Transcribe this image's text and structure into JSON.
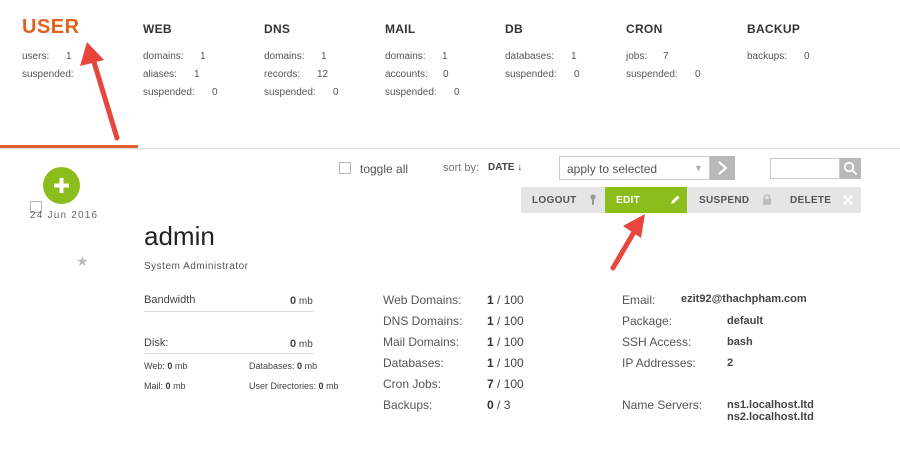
{
  "stats": {
    "user": {
      "title": "USER",
      "rows": [
        {
          "label": "users:",
          "value": "1"
        },
        {
          "label": "suspended:",
          "value": ""
        }
      ]
    },
    "web": {
      "title": "WEB",
      "rows": [
        {
          "label": "domains:",
          "value": "1"
        },
        {
          "label": "aliases:",
          "value": "1"
        },
        {
          "label": "suspended:",
          "value": "0"
        }
      ]
    },
    "dns": {
      "title": "DNS",
      "rows": [
        {
          "label": "domains:",
          "value": "1"
        },
        {
          "label": "records:",
          "value": "12"
        },
        {
          "label": "suspended:",
          "value": "0"
        }
      ]
    },
    "mail": {
      "title": "MAIL",
      "rows": [
        {
          "label": "domains:",
          "value": "1"
        },
        {
          "label": "accounts:",
          "value": "0"
        },
        {
          "label": "suspended:",
          "value": "0"
        }
      ]
    },
    "db": {
      "title": "DB",
      "rows": [
        {
          "label": "databases:",
          "value": "1"
        },
        {
          "label": "suspended:",
          "value": "0"
        }
      ]
    },
    "cron": {
      "title": "CRON",
      "rows": [
        {
          "label": "jobs:",
          "value": "7"
        },
        {
          "label": "suspended:",
          "value": "0"
        }
      ]
    },
    "backup": {
      "title": "BACKUP",
      "rows": [
        {
          "label": "backups:",
          "value": "0"
        }
      ]
    }
  },
  "toolbar": {
    "toggle_all": "toggle all",
    "sort_by": "sort by:",
    "sort_value": "DATE ↓",
    "bulk_action": "apply to selected",
    "search_placeholder": ""
  },
  "user": {
    "date": "24  Jun  2016",
    "name": "admin",
    "role": "System Administrator",
    "actions": {
      "logout": "LOGOUT",
      "edit": "EDIT",
      "suspend": "SUSPEND",
      "delete": "DELETE"
    },
    "bandwidth": {
      "label": "Bandwidth",
      "value": "0",
      "unit": "mb"
    },
    "disk": {
      "label": "Disk:",
      "value": "0",
      "unit": "mb"
    },
    "disk_breakdown": {
      "web": {
        "label": "Web:",
        "value": "0",
        "unit": "mb"
      },
      "databases": {
        "label": "Databases:",
        "value": "0",
        "unit": "mb"
      },
      "mail": {
        "label": "Mail:",
        "value": "0",
        "unit": "mb"
      },
      "user_dirs": {
        "label": "User Directories:",
        "value": "0",
        "unit": "mb"
      }
    },
    "limits": [
      {
        "label": "Web Domains:",
        "used": "1",
        "limit": "/ 100"
      },
      {
        "label": "DNS Domains:",
        "used": "1",
        "limit": "/ 100"
      },
      {
        "label": "Mail Domains:",
        "used": "1",
        "limit": "/ 100"
      },
      {
        "label": "Databases:",
        "used": "1",
        "limit": "/ 100"
      },
      {
        "label": "Cron Jobs:",
        "used": "7",
        "limit": "/ 100"
      },
      {
        "label": "Backups:",
        "used": "0",
        "limit": "/ 3"
      }
    ],
    "info": {
      "email_label": "Email:",
      "email": "ezit92@thachpham.com",
      "package_label": "Package:",
      "package": "default",
      "ssh_label": "SSH Access:",
      "ssh": "bash",
      "ip_label": "IP Addresses:",
      "ip": "2",
      "ns_label": "Name Servers:",
      "ns1": "ns1.localhost.ltd",
      "ns2": "ns2.localhost.ltd"
    }
  },
  "colors": {
    "accent": "#e0601c",
    "edit_green": "#8bbd1c",
    "annotation_red": "#e8453c"
  }
}
